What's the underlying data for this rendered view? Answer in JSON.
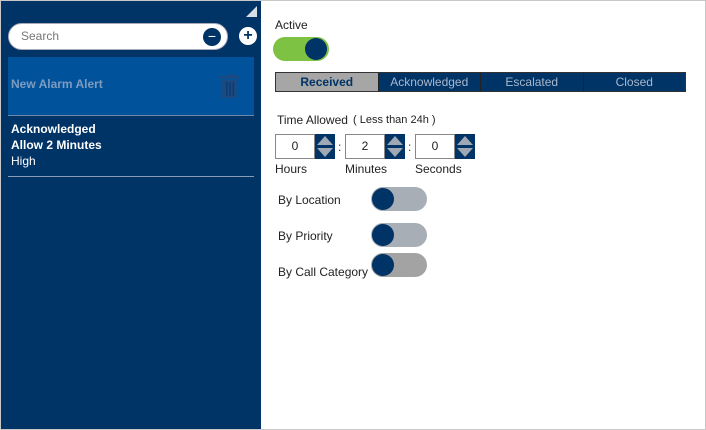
{
  "sidebar": {
    "search_placeholder": "Search",
    "alarm_title": "New Alarm Alert",
    "details": {
      "status": "Acknowledged",
      "allow": "Allow 2 Minutes",
      "priority": "High"
    }
  },
  "main": {
    "active_label": "Active",
    "active_on": true,
    "tabs": [
      {
        "label": "Received",
        "selected": true
      },
      {
        "label": "Acknowledged"
      },
      {
        "label": "Escalated"
      },
      {
        "label": "Closed"
      }
    ],
    "time_allowed": "Time Allowed",
    "time_note": "( Less than 24h )",
    "time": {
      "hours": "0",
      "minutes": "2",
      "seconds": "0",
      "hours_label": "Hours",
      "minutes_label": "Minutes",
      "seconds_label": "Seconds"
    },
    "filters": [
      {
        "label": "By Location",
        "on": false
      },
      {
        "label": "By Priority",
        "on": false
      },
      {
        "label": "By Call Category",
        "on": false
      }
    ]
  },
  "colors": {
    "sidebar": "#003366",
    "accent_green": "#7dc242"
  }
}
